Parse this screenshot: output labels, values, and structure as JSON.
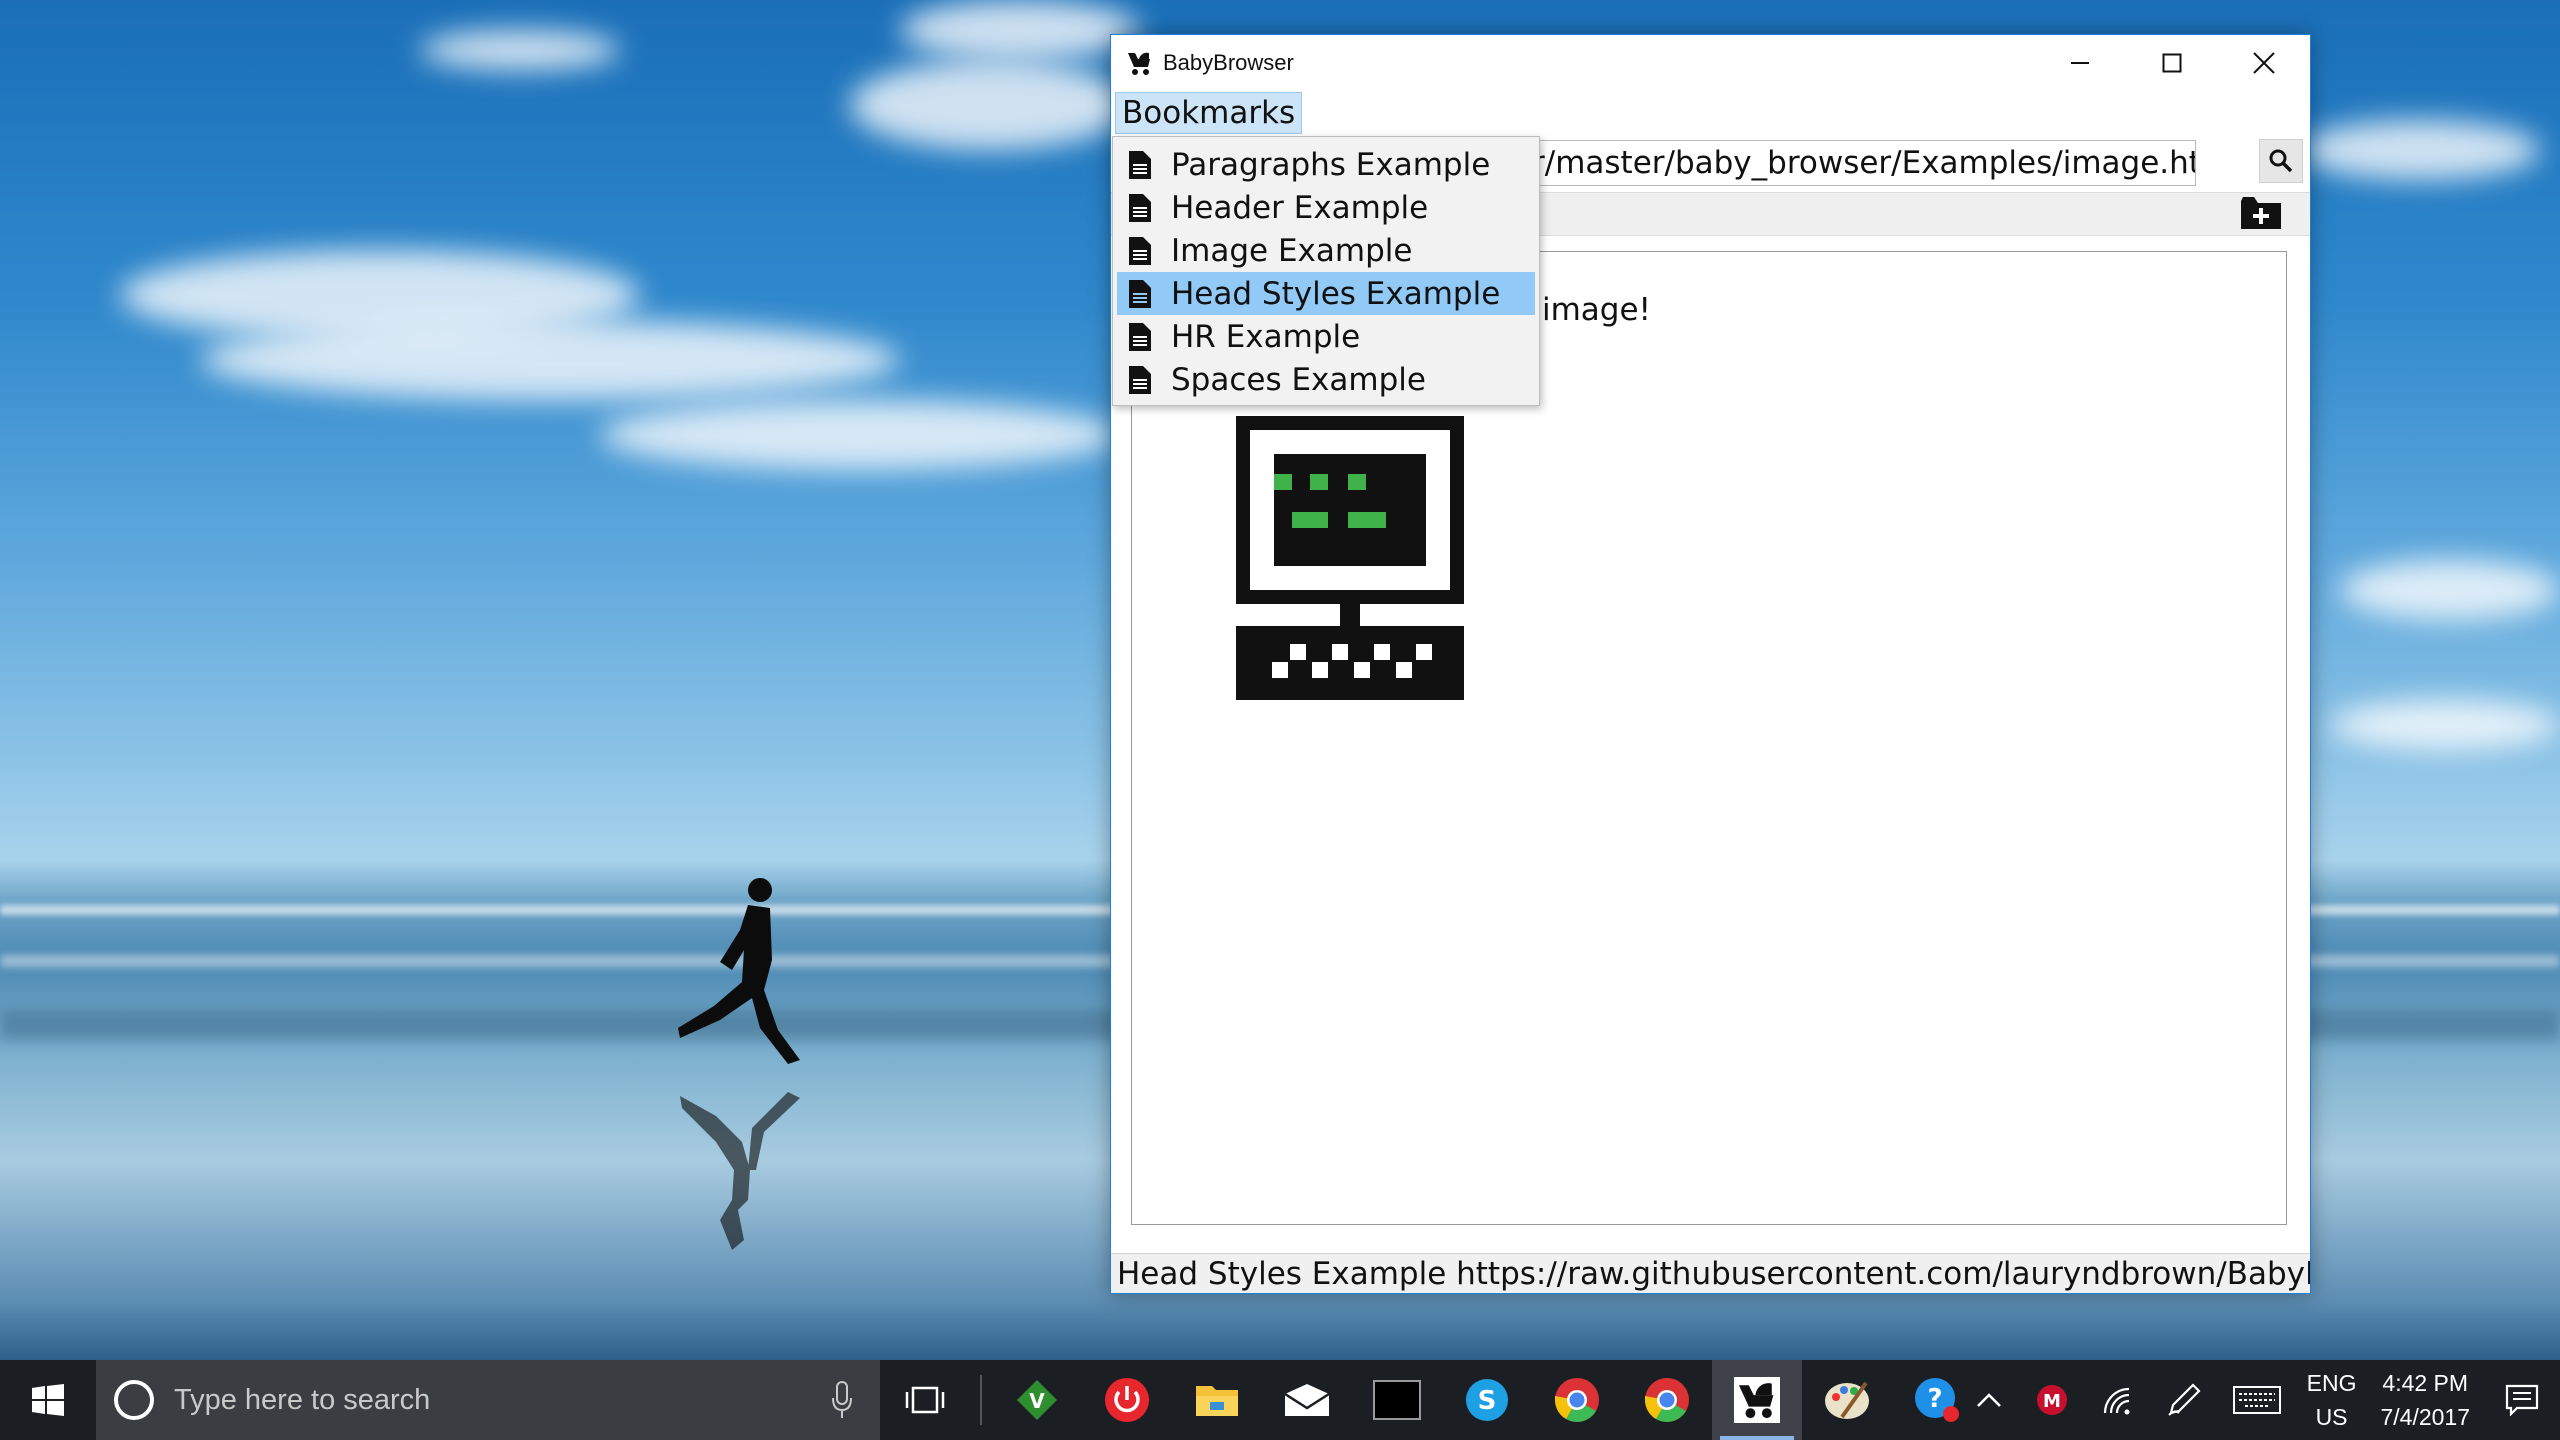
{
  "window": {
    "title": "BabyBrowser",
    "menu": {
      "bookmarks_label": "Bookmarks"
    },
    "url_value": "r/master/baby_browser/Examples/image.html",
    "content_text": "image!",
    "status_text": "Head Styles Example https://raw.githubusercontent.com/lauryndbrown/BabyB"
  },
  "bookmarks_menu": {
    "items": [
      {
        "label": "Paragraphs Example"
      },
      {
        "label": "Header Example"
      },
      {
        "label": "Image Example"
      },
      {
        "label": "Head Styles Example",
        "highlighted": true
      },
      {
        "label": "HR Example"
      },
      {
        "label": "Spaces Example"
      }
    ]
  },
  "taskbar": {
    "search_placeholder": "Type here to search",
    "language_line1": "ENG",
    "language_line2": "US",
    "time": "4:42 PM",
    "date": "7/4/2017",
    "pinned_icons": [
      "task-view-icon",
      "vim-icon",
      "power-app-icon",
      "file-explorer-icon",
      "mail-icon",
      "terminal-icon",
      "skype-icon",
      "chrome-icon",
      "chrome-icon",
      "babybrowser-icon",
      "paint-icon",
      "help-icon"
    ]
  },
  "colors": {
    "menu_highlight": "#91c9f7",
    "bookmarks_menu_button": "#cce4f7",
    "window_border": "#1d7fe0",
    "screen_green": "#3fb24a",
    "taskbar": "#1b1f24"
  }
}
